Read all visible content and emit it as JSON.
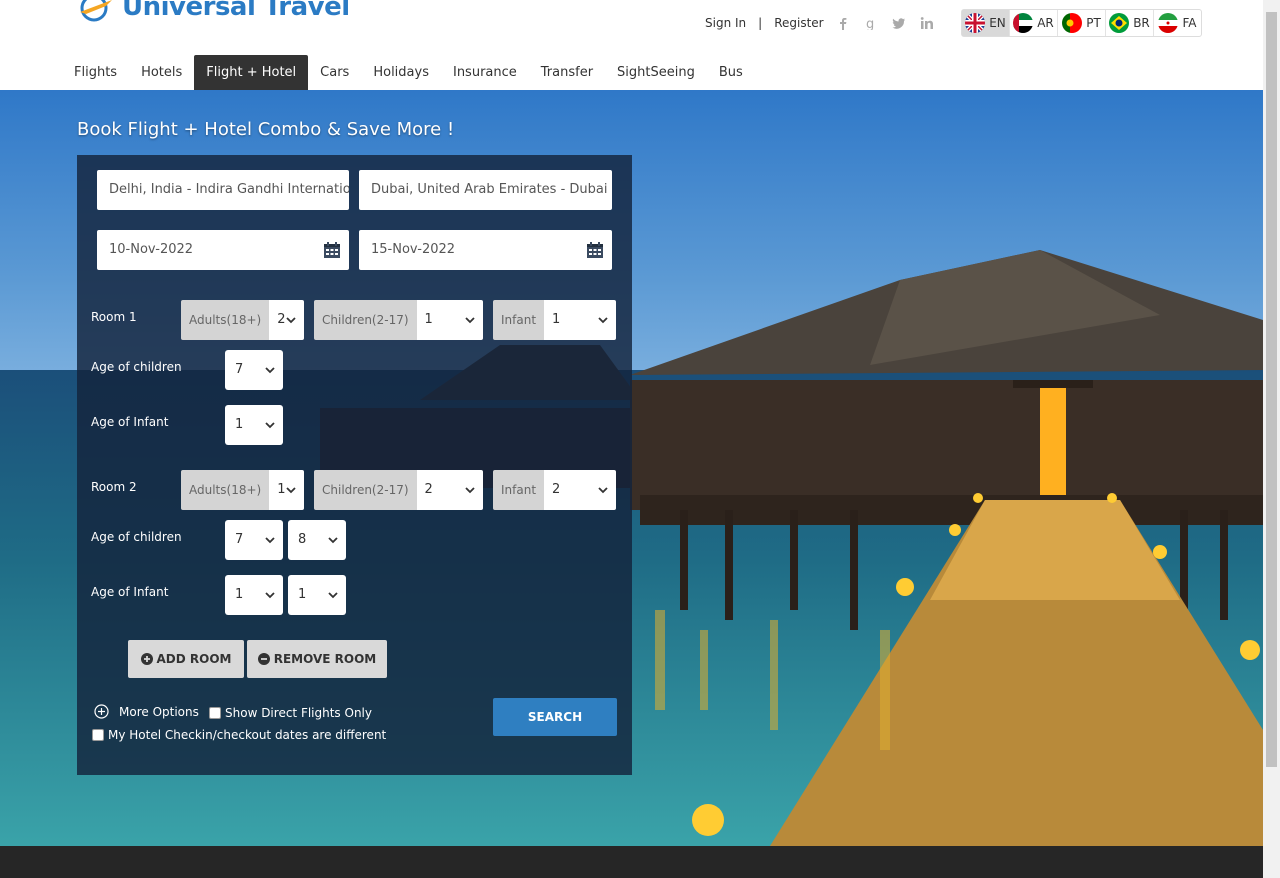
{
  "brand": {
    "name": "Universal Travel"
  },
  "auth": {
    "signin": "Sign In",
    "separator": "|",
    "register": "Register"
  },
  "social": [
    "facebook-icon",
    "google-icon",
    "twitter-icon",
    "linkedin-icon"
  ],
  "languages": [
    {
      "code": "EN",
      "active": true
    },
    {
      "code": "AR",
      "active": false
    },
    {
      "code": "PT",
      "active": false
    },
    {
      "code": "BR",
      "active": false
    },
    {
      "code": "FA",
      "active": false
    }
  ],
  "nav": [
    "Flights",
    "Hotels",
    "Flight + Hotel",
    "Cars",
    "Holidays",
    "Insurance",
    "Transfer",
    "SightSeeing",
    "Bus"
  ],
  "hero": {
    "title": "Book Flight + Hotel Combo & Save More !"
  },
  "form": {
    "from": "Delhi, India - Indira Gandhi International",
    "to": "Dubai, United Arab Emirates - Dubai (DXB)",
    "depart": "10-Nov-2022",
    "return": "15-Nov-2022",
    "labels": {
      "adults": "Adults(18+)",
      "children": "Children(2-17)",
      "infant": "Infant",
      "age_children": "Age of children",
      "age_infant": "Age of Infant"
    },
    "rooms": [
      {
        "label": "Room 1",
        "adults": "2",
        "children": "1",
        "infant": "1",
        "child_ages": [
          "7"
        ],
        "infant_ages": [
          "1"
        ]
      },
      {
        "label": "Room 2",
        "adults": "1",
        "children": "2",
        "infant": "2",
        "child_ages": [
          "7",
          "8"
        ],
        "infant_ages": [
          "1",
          "1"
        ]
      }
    ],
    "add_room": "ADD ROOM",
    "remove_room": "REMOVE ROOM",
    "more_options": "More Options",
    "direct_flights": "Show Direct Flights Only",
    "hotel_dates": "My Hotel Checkin/checkout dates are different",
    "search": "SEARCH"
  },
  "colors": {
    "brand": "#2b7bc4",
    "nav_active": "#333333",
    "search": "#2f7fc1"
  }
}
